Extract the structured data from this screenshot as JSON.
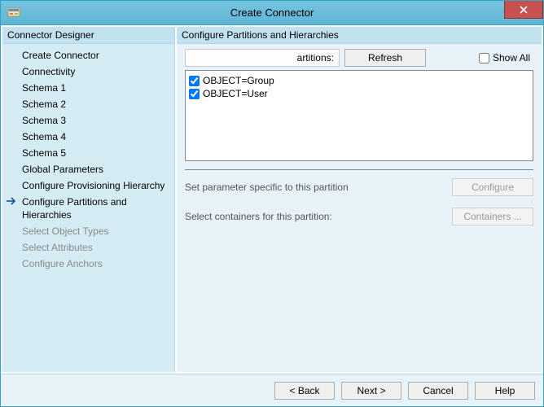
{
  "window": {
    "title": "Create Connector"
  },
  "sidebar": {
    "header": "Connector Designer",
    "items": [
      {
        "label": "Create Connector",
        "state": "done"
      },
      {
        "label": "Connectivity",
        "state": "done"
      },
      {
        "label": "Schema 1",
        "state": "done"
      },
      {
        "label": "Schema 2",
        "state": "done"
      },
      {
        "label": "Schema 3",
        "state": "done"
      },
      {
        "label": "Schema 4",
        "state": "done"
      },
      {
        "label": "Schema 5",
        "state": "done"
      },
      {
        "label": "Global Parameters",
        "state": "done"
      },
      {
        "label": "Configure Provisioning Hierarchy",
        "state": "done"
      },
      {
        "label": "Configure Partitions and Hierarchies",
        "state": "current"
      },
      {
        "label": "Select Object Types",
        "state": "future"
      },
      {
        "label": "Select Attributes",
        "state": "future"
      },
      {
        "label": "Configure Anchors",
        "state": "future"
      }
    ]
  },
  "main": {
    "header": "Configure Partitions and Hierarchies",
    "partitions_label": "artitions:",
    "refresh_label": "Refresh",
    "showall_label": "Show All",
    "showall_checked": false,
    "items": [
      {
        "label": "OBJECT=Group",
        "checked": true
      },
      {
        "label": "OBJECT=User",
        "checked": true
      }
    ],
    "param_text": "Set parameter specific to this partition",
    "configure_label": "Configure",
    "containers_text": "Select containers for this partition:",
    "containers_label": "Containers ..."
  },
  "footer": {
    "back": "<  Back",
    "next": "Next  >",
    "cancel": "Cancel",
    "help": "Help"
  }
}
